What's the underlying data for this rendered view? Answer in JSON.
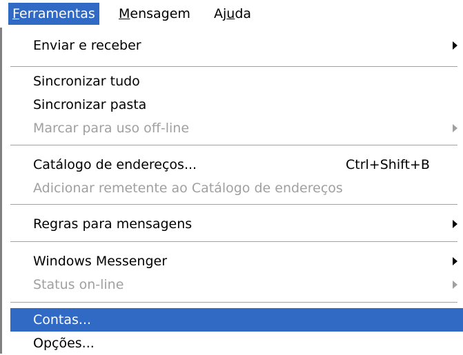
{
  "menubar": {
    "items": [
      {
        "label": "Ferramentas"
      },
      {
        "label": "Mensagem"
      },
      {
        "label": "Ajuda"
      }
    ]
  },
  "menu": {
    "items": [
      {
        "label": "Enviar e receber",
        "submenu": true,
        "enabled": true
      },
      {
        "label": "Sincronizar tudo",
        "enabled": true
      },
      {
        "label": "Sincronizar pasta",
        "enabled": true
      },
      {
        "label": "Marcar para uso off-line",
        "submenu": true,
        "enabled": false
      },
      {
        "label": "Catálogo de endereços...",
        "shortcut": "Ctrl+Shift+B",
        "enabled": true
      },
      {
        "label": "Adicionar remetente ao Catálogo de endereços",
        "enabled": false
      },
      {
        "label": "Regras para mensagens",
        "submenu": true,
        "enabled": true
      },
      {
        "label": "Windows Messenger",
        "submenu": true,
        "enabled": true
      },
      {
        "label": "Status on-line",
        "submenu": true,
        "enabled": false
      },
      {
        "label": "Contas...",
        "enabled": true,
        "highlighted": true
      },
      {
        "label": "Opções...",
        "enabled": true
      }
    ]
  },
  "colors": {
    "highlight": "#316ac5",
    "disabled_text": "#a0a0a0"
  }
}
